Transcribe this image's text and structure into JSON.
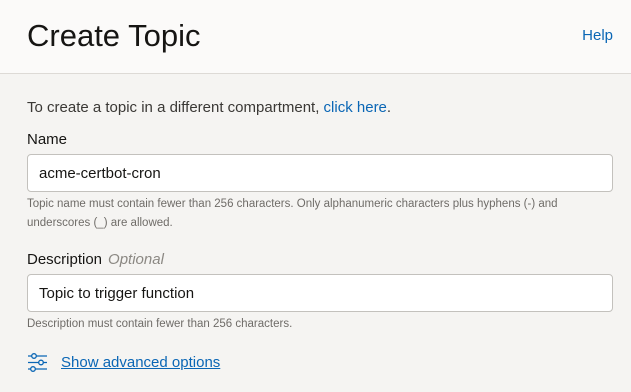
{
  "header": {
    "title": "Create Topic",
    "help_label": "Help"
  },
  "form": {
    "intro_text": "To create a topic in a different compartment, ",
    "intro_link": "click here",
    "intro_end": ".",
    "name": {
      "label": "Name",
      "value": "acme-certbot-cron",
      "hint": "Topic name must contain fewer than 256 characters. Only alphanumeric characters plus hyphens (-) and underscores (_) are allowed."
    },
    "description": {
      "label": "Description",
      "optional_label": "Optional",
      "value": "Topic to trigger function",
      "hint": "Description must contain fewer than 256 characters."
    },
    "advanced": {
      "label": "Show advanced options",
      "icon": "sliders-icon"
    }
  },
  "colors": {
    "link": "#0a66b5",
    "background": "#f5f4f2",
    "header_background": "#fbfaf9"
  }
}
